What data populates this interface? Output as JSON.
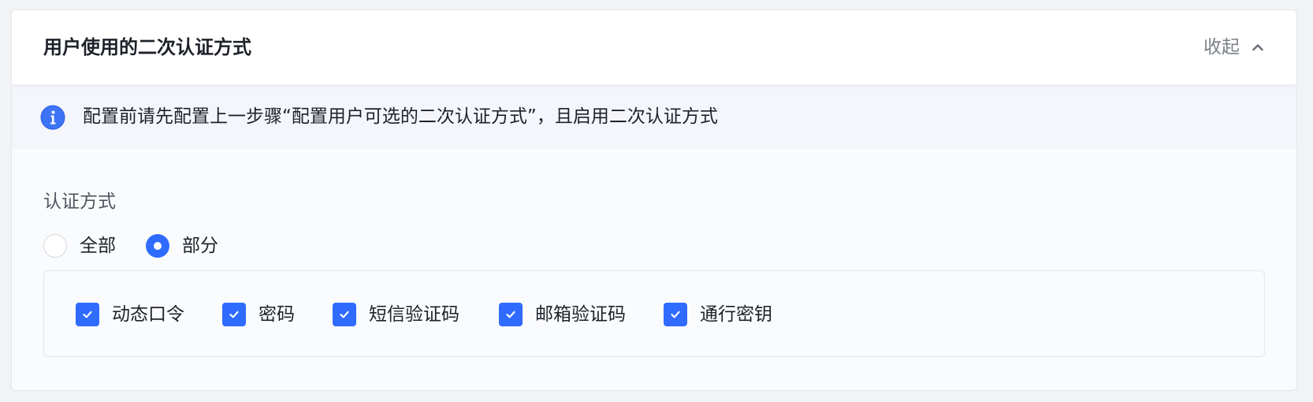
{
  "header": {
    "title": "用户使用的二次认证方式",
    "collapse_label": "收起",
    "collapse_icon": "chevron-up-icon"
  },
  "notice": {
    "icon": "info-icon",
    "text": "配置前请先配置上一步骤“配置用户可选的二次认证方式”，且启用二次认证方式"
  },
  "auth": {
    "label": "认证方式",
    "options": [
      {
        "label": "全部",
        "checked": false
      },
      {
        "label": "部分",
        "checked": true
      }
    ],
    "methods": [
      {
        "label": "动态口令",
        "checked": true
      },
      {
        "label": "密码",
        "checked": true
      },
      {
        "label": "短信验证码",
        "checked": true
      },
      {
        "label": "邮箱验证码",
        "checked": true
      },
      {
        "label": "通行密钥",
        "checked": true
      }
    ]
  },
  "colors": {
    "accent": "#2f6bff",
    "text": "#1d2129",
    "muted": "#7a7f87",
    "notice_bg": "#f4f6fb"
  }
}
